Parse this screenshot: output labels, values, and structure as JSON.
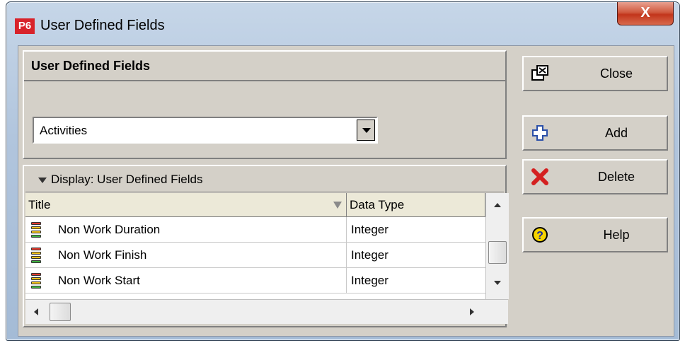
{
  "window": {
    "title": "User Defined Fields",
    "logo": "P6",
    "close_glyph": "X"
  },
  "header": {
    "title": "User Defined Fields"
  },
  "subject_area": {
    "value": "Activities"
  },
  "display": {
    "label": "Display: User Defined Fields"
  },
  "table": {
    "columns": [
      "Title",
      "Data Type"
    ],
    "rows": [
      {
        "title": "Non Work Duration",
        "data_type": "Integer"
      },
      {
        "title": "Non Work Finish",
        "data_type": "Integer"
      },
      {
        "title": "Non Work Start",
        "data_type": "Integer"
      }
    ]
  },
  "buttons": {
    "close": "Close",
    "add": "Add",
    "delete": "Delete",
    "help": "Help"
  },
  "icons": {
    "close": "close-window-icon",
    "add": "plus-icon",
    "delete": "red-x-icon",
    "help": "question-icon",
    "udf": "udf-stack-icon"
  },
  "colors": {
    "udf_red": "#e23b2e",
    "udf_yellow": "#f2c21a",
    "udf_green": "#3fb040",
    "help_yellow": "#f5d400",
    "delete_red": "#d42020"
  }
}
